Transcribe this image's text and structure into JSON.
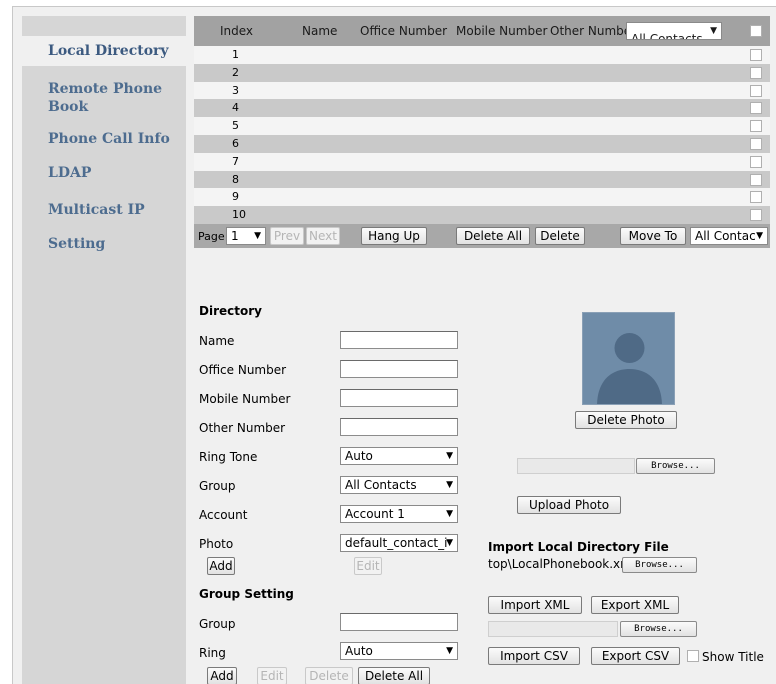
{
  "sidebar": {
    "items": [
      {
        "label": "Local Directory"
      },
      {
        "label": "Remote Phone Book"
      },
      {
        "label": "Phone Call Info"
      },
      {
        "label": "LDAP"
      },
      {
        "label": "Multicast IP"
      },
      {
        "label": "Setting"
      }
    ]
  },
  "table": {
    "headers": {
      "index": "Index",
      "name": "Name",
      "office": "Office Number",
      "mobile": "Mobile Number",
      "other": "Other Number"
    },
    "filter": "All Contacts",
    "rows": [
      "1",
      "2",
      "3",
      "4",
      "5",
      "6",
      "7",
      "8",
      "9",
      "10"
    ]
  },
  "pager": {
    "label": "Page",
    "page": "1",
    "prev": "Prev",
    "next": "Next",
    "hang_up": "Hang Up",
    "delete_all": "Delete All",
    "delete": "Delete",
    "move_to": "Move To",
    "move_target": "All Contac"
  },
  "directory": {
    "title": "Directory",
    "name_label": "Name",
    "office_label": "Office Number",
    "mobile_label": "Mobile Number",
    "other_label": "Other Number",
    "ring_label": "Ring Tone",
    "ring_value": "Auto",
    "group_label": "Group",
    "group_value": "All Contacts",
    "account_label": "Account",
    "account_value": "Account 1",
    "photo_label": "Photo",
    "photo_value": "default_contact_i",
    "add": "Add",
    "edit": "Edit"
  },
  "group_setting": {
    "title": "Group Setting",
    "group_label": "Group",
    "ring_label": "Ring",
    "ring_value": "Auto",
    "add": "Add",
    "edit": "Edit",
    "delete": "Delete",
    "delete_all": "Delete All"
  },
  "photo_panel": {
    "delete_photo": "Delete Photo",
    "browse": "Browse...",
    "upload_photo": "Upload Photo"
  },
  "import": {
    "title": "Import Local Directory File",
    "file_path": "top\\LocalPhonebook.xml",
    "browse": "Browse...",
    "import_xml": "Import XML",
    "export_xml": "Export XML",
    "import_csv": "Import CSV",
    "export_csv": "Export CSV",
    "show_title": "Show Title"
  },
  "colors": {
    "sidebar_bg": "#d6d6d6",
    "nav_text": "#4d6c8f",
    "header_bg": "#a2a2a2",
    "row_alt": "#c9c9c9",
    "avatar_bg": "#6f8ca8"
  }
}
